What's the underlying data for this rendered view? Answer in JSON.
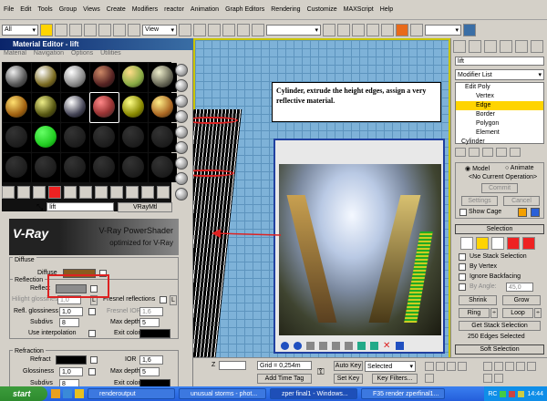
{
  "menubar": {
    "items": [
      "File",
      "Edit",
      "Tools",
      "Group",
      "Views",
      "Create",
      "Modifiers",
      "reactor",
      "Animation",
      "Graph Editors",
      "Rendering",
      "Customize",
      "MAXScript",
      "Help"
    ]
  },
  "toolbar": {
    "selection_filter": "All",
    "view_dropdown": "View"
  },
  "material_editor": {
    "title": "Material Editor - lift",
    "menu": [
      "Material",
      "Navigation",
      "Options",
      "Utilities"
    ],
    "material_name": "lift",
    "material_type": "VRayMtl",
    "vray_banner": {
      "brand": "V-Ray",
      "title": "V-Ray PowerShader",
      "subtitle": "optimized for V-Ray"
    },
    "diffuse": {
      "section": "Diffuse",
      "label": "Diffuse",
      "color": "#8b5a1e"
    },
    "reflection": {
      "section": "Reflection",
      "reflect_label": "Reflect",
      "reflect_color": "#8c8c8c",
      "hilight_glossiness_label": "Hilight glossiness",
      "hilight_glossiness_value": "1,0",
      "hilight_glossiness_toggle": "L",
      "fresnel_label": "Fresnel reflections",
      "fresnel_toggle": "L",
      "fresnel_ior_label": "Fresnel IOR",
      "fresnel_ior_value": "1,6",
      "refl_glossiness_label": "Refl. glossiness",
      "refl_glossiness_value": "1,0",
      "max_depth_label": "Max depth",
      "max_depth_value": "5",
      "subdivs_label": "Subdivs",
      "subdivs_value": "8",
      "use_interpolation_label": "Use interpolation",
      "exit_color_label": "Exit color",
      "exit_color": "#000000"
    },
    "refraction": {
      "section": "Refraction",
      "refract_label": "Refract",
      "refract_color": "#000000",
      "ior_label": "IOR",
      "ior_value": "1,6",
      "glossiness_label": "Glossiness",
      "glossiness_value": "1,0",
      "max_depth_label": "Max depth",
      "max_depth_value": "5",
      "subdivs_label": "Subdivs",
      "subdivs_value": "8",
      "exit_color_label": "Exit color",
      "exit_color": "#000000"
    }
  },
  "callout": {
    "text": "Cylinder, extrude the height edges, assign a very reflective material."
  },
  "command_panel": {
    "object_name": "lift",
    "modifier_list": "Modifier List",
    "stack": [
      "Edit Poly",
      "Vertex",
      "Edge",
      "Border",
      "Polygon",
      "Element",
      "Cylinder"
    ],
    "stack_selected_index": 2,
    "edit_mode": {
      "model": "Model",
      "animate": "Animate",
      "current_op": "<No Current Operation>",
      "commit": "Commit",
      "settings": "Settings",
      "cancel": "Cancel",
      "show_cage": "Show Cage"
    },
    "selection": {
      "header": "Selection",
      "use_stack_selection": "Use Stack Selection",
      "by_vertex": "By Vertex",
      "ignore_backfacing": "Ignore Backfacing",
      "by_angle": "By Angle:",
      "by_angle_value": "45,0",
      "shrink": "Shrink",
      "grow": "Grow",
      "ring": "Ring",
      "loop": "Loop",
      "get_stack_selection": "Get Stack Selection",
      "status": "250 Edges Selected"
    },
    "soft_selection": "Soft Selection"
  },
  "bottom_bar": {
    "grid": "Grid = 0,254m",
    "add_time_tag": "Add Time Tag",
    "auto_key": "Auto Key",
    "selected": "Selected",
    "set_key": "Set Key",
    "key_filters": "Key Filters...",
    "coord_z": "Z"
  },
  "taskbar": {
    "start": "start",
    "tasks": [
      "renderoutput",
      "unusual storms - phot...",
      "zper final1 - Windows...",
      "F35 render zperfinal1..."
    ],
    "tray": "RC",
    "clock": "14:44"
  }
}
